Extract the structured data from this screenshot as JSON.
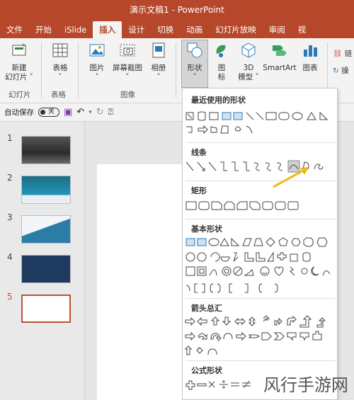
{
  "window": {
    "title": "演示文稿1  -  PowerPoint"
  },
  "tabs": [
    "文件",
    "开始",
    "iSlide",
    "插入",
    "设计",
    "切换",
    "动画",
    "幻灯片放映",
    "审阅",
    "视"
  ],
  "active_tab": "插入",
  "ribbon": {
    "new_slide": "新建\n幻灯片 ˅",
    "table": "表格\n˅",
    "picture": "图片\n˅",
    "screenshot": "屏幕截图\n˅",
    "album": "相册\n˅",
    "shapes": "形状\n˅",
    "icons": "图\n标",
    "model3d": "3D\n模型 ˅",
    "smartart": "SmartArt",
    "chart": "图表",
    "right1": "链",
    "right2": "操",
    "groups": {
      "slides": "幻灯片",
      "tables": "表格",
      "images": "图像"
    }
  },
  "qat": {
    "autosave": "自动保存",
    "toggle": "关"
  },
  "slides": [
    {
      "num": "1",
      "color": "#3b3b3b"
    },
    {
      "num": "2",
      "color": "#1d6f8a"
    },
    {
      "num": "3",
      "color": "#2a7ea6"
    },
    {
      "num": "4",
      "color": "#1f3a5f"
    },
    {
      "num": "5",
      "color": "#ffffff"
    }
  ],
  "dropdown": {
    "recent": "最近使用的形状",
    "lines": "线条",
    "rect": "矩形",
    "basic": "基本形状",
    "arrows": "箭头总汇",
    "formula": "公式形状"
  },
  "watermark": "风行手游网"
}
